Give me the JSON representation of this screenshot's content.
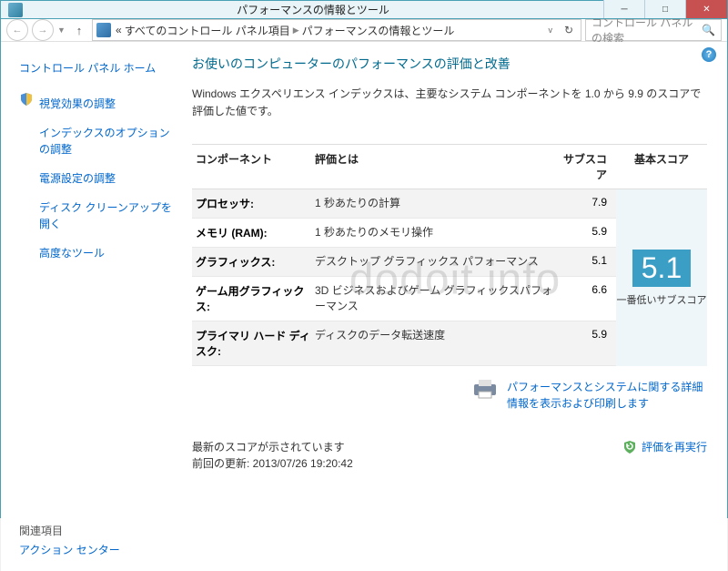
{
  "window": {
    "title": "パフォーマンスの情報とツール"
  },
  "nav": {
    "crumb_prefix": "«",
    "crumb1": "すべてのコントロール パネル項目",
    "crumb2": "パフォーマンスの情報とツール",
    "search_placeholder": "コントロール パネルの検索"
  },
  "sidebar": {
    "home": "コントロール パネル ホーム",
    "tasks": [
      "視覚効果の調整",
      "インデックスのオプションの調整",
      "電源設定の調整",
      "ディスク クリーンアップを開く",
      "高度なツール"
    ],
    "related_label": "関連項目",
    "related_link": "アクション センター"
  },
  "main": {
    "heading": "お使いのコンピューターのパフォーマンスの評価と改善",
    "desc": "Windows エクスペリエンス インデックスは、主要なシステム コンポーネントを 1.0 から 9.9 のスコアで評価した値です。",
    "headers": {
      "component": "コンポーネント",
      "what": "評価とは",
      "sub": "サブスコア",
      "base": "基本スコア"
    },
    "rows": [
      {
        "comp": "プロセッサ:",
        "desc": "1 秒あたりの計算",
        "sub": "7.9",
        "shaded": true
      },
      {
        "comp": "メモリ (RAM):",
        "desc": "1 秒あたりのメモリ操作",
        "sub": "5.9",
        "shaded": false
      },
      {
        "comp": "グラフィックス:",
        "desc": "デスクトップ グラフィックス パフォーマンス",
        "sub": "5.1",
        "shaded": true
      },
      {
        "comp": "ゲーム用グラフィックス:",
        "desc": "3D ビジネスおよびゲーム グラフィックスパフォーマンス",
        "sub": "6.6",
        "shaded": false
      },
      {
        "comp": "プライマリ ハード ディスク:",
        "desc": "ディスクのデータ転送速度",
        "sub": "5.9",
        "shaded": true
      }
    ],
    "base_score": "5.1",
    "base_label": "一番低いサブスコア",
    "print_link": "パフォーマンスとシステムに関する詳細情報を表示および印刷します",
    "update_line1": "最新のスコアが示されています",
    "update_line2": "前回の更新: 2013/07/26 19:20:42",
    "rerun": "評価を再実行"
  },
  "watermark": "dodoit.info"
}
